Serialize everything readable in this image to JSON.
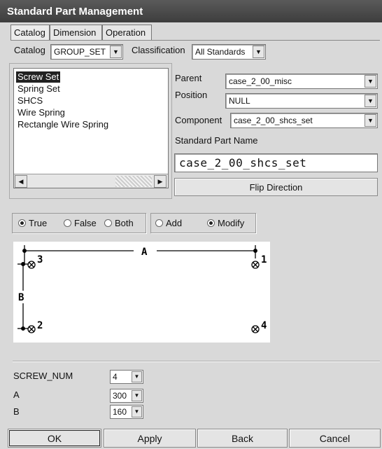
{
  "window": {
    "title": "Standard Part Management"
  },
  "tabs": [
    {
      "label": "Catalog"
    },
    {
      "label": "Dimension"
    },
    {
      "label": "Operation"
    }
  ],
  "catalog": {
    "catalog_label": "Catalog",
    "catalog_value": "GROUP_SET",
    "classification_label": "Classification",
    "classification_value": "All Standards"
  },
  "part_list": {
    "items": [
      "Screw Set",
      "Spring Set",
      "SHCS",
      "Wire Spring",
      "Rectangle Wire Spring"
    ],
    "selected_index": 0
  },
  "details": {
    "parent_label": "Parent",
    "parent_value": "case_2_00_misc",
    "position_label": "Position",
    "position_value": "NULL",
    "component_label": "Component",
    "component_value": "case_2_00_shcs_set",
    "name_label": "Standard Part Name",
    "name_value": "case_2_00_shcs_set",
    "flip_label": "Flip Direction"
  },
  "options": {
    "state": [
      "True",
      "False",
      "Both"
    ],
    "state_selected": "True",
    "mode": [
      "Add",
      "Modify"
    ],
    "mode_selected": "Modify"
  },
  "diagram": {
    "labels": {
      "dim_a": "A",
      "dim_b": "B",
      "p1": "1",
      "p2": "2",
      "p3": "3",
      "p4": "4"
    }
  },
  "parameters": [
    {
      "name": "SCREW_NUM",
      "value": "4"
    },
    {
      "name": "A",
      "value": "300"
    },
    {
      "name": "B",
      "value": "160"
    }
  ],
  "actions": {
    "ok": "OK",
    "apply": "Apply",
    "back": "Back",
    "cancel": "Cancel"
  }
}
